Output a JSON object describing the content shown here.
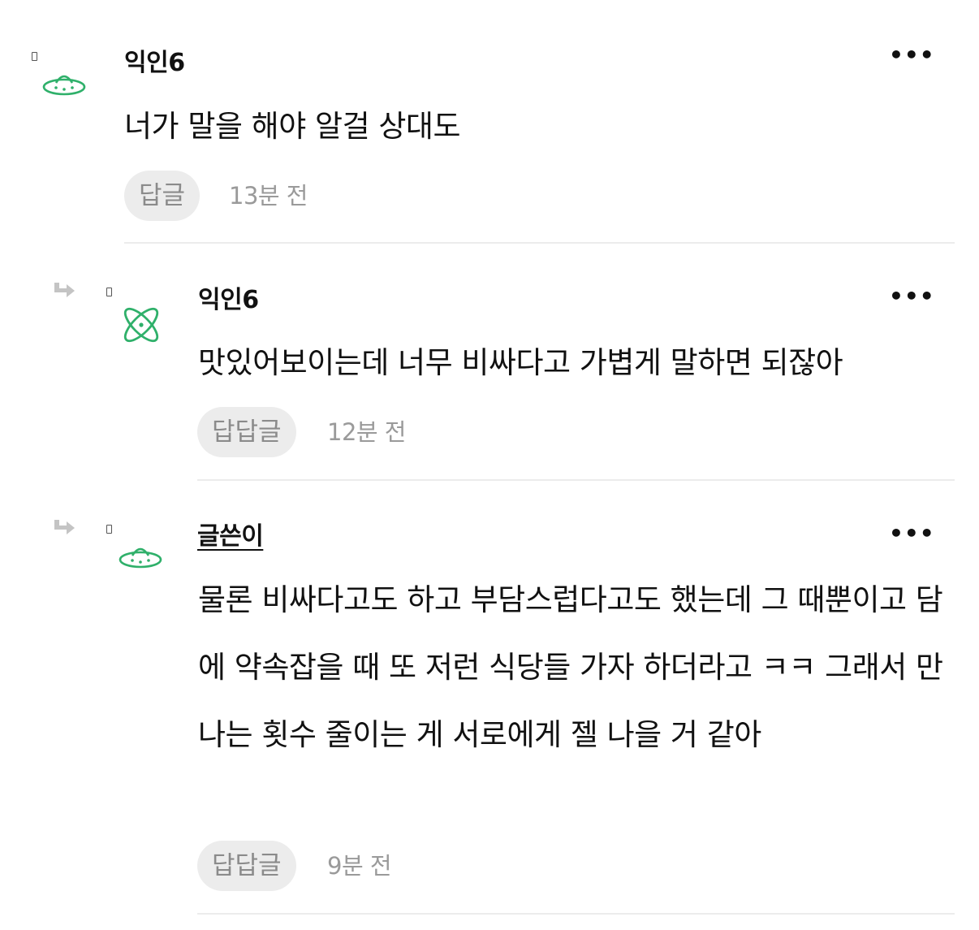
{
  "colors": {
    "avatar_green": "#2fb06a",
    "reply_bg": "#ececec",
    "muted_text": "#9a9a9a",
    "divider": "#ececec"
  },
  "comments": [
    {
      "author": "익인6",
      "avatar_icon": "ufo-icon",
      "text": "너가 말을 해야 알걸 상대도",
      "reply_label": "답글",
      "time": "13분 전",
      "more_label": "•••"
    },
    {
      "author": "익인6",
      "avatar_icon": "atom-icon",
      "text": "맛있어보이는데 너무 비싸다고 가볍게 말하면 되잖아",
      "reply_label": "답답글",
      "time": "12분 전",
      "more_label": "•••"
    },
    {
      "author": "글쓴이",
      "avatar_icon": "ufo-icon",
      "text": "물론 비싸다고도 하고 부담스럽다고도 했는데 그 때뿐이고 담에 약속잡을 때 또 저런 식당들 가자 하더라고 ㅋㅋ 그래서 만나는 횟수 줄이는 게 서로에게 젤 나을 거 같아",
      "reply_label": "답답글",
      "time": "9분 전",
      "more_label": "•••"
    }
  ]
}
